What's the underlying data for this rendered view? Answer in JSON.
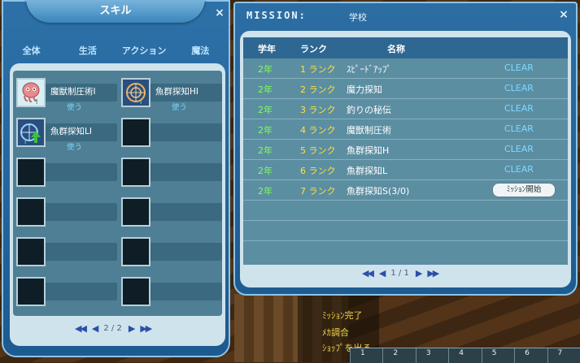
{
  "skill_window": {
    "title": "スキル",
    "close": "×",
    "tabs": [
      "全体",
      "生活",
      "アクション",
      "魔法"
    ],
    "slots": [
      {
        "name": "魔獣制圧術Ⅰ",
        "action": "使う",
        "icon": "octopus-icon"
      },
      {
        "name": "魚群探知HⅠ",
        "action": "使う",
        "icon": "fish-radar-icon"
      },
      {
        "name": "魚群探知LⅠ",
        "action": "使う",
        "icon": "fish-radar-up-icon"
      },
      {
        "name": "",
        "action": "",
        "icon": "empty-slot"
      },
      {
        "name": "",
        "action": "",
        "icon": "empty-slot"
      },
      {
        "name": "",
        "action": "",
        "icon": "empty-slot"
      },
      {
        "name": "",
        "action": "",
        "icon": "empty-slot"
      },
      {
        "name": "",
        "action": "",
        "icon": "empty-slot"
      },
      {
        "name": "",
        "action": "",
        "icon": "empty-slot"
      },
      {
        "name": "",
        "action": "",
        "icon": "empty-slot"
      },
      {
        "name": "",
        "action": "",
        "icon": "empty-slot"
      },
      {
        "name": "",
        "action": "",
        "icon": "empty-slot"
      }
    ],
    "pager": {
      "first": "◀◀",
      "prev": "◀",
      "page": "2 / 2",
      "next": "▶",
      "last": "▶▶"
    }
  },
  "mission_window": {
    "title": "MISSION:",
    "subtitle": "学校",
    "close": "×",
    "headers": {
      "year": "学年",
      "rank": "ランク",
      "name": "名称"
    },
    "rows": [
      {
        "year": "2年",
        "rank": "1 ランク",
        "name": "ｽﾋﾟｰﾄﾞｱｯﾌﾟ",
        "status": "CLEAR"
      },
      {
        "year": "2年",
        "rank": "2 ランク",
        "name": "魔力探知",
        "status": "CLEAR"
      },
      {
        "year": "2年",
        "rank": "3 ランク",
        "name": "釣りの秘伝",
        "status": "CLEAR"
      },
      {
        "year": "2年",
        "rank": "4 ランク",
        "name": "魔獣制圧術",
        "status": "CLEAR"
      },
      {
        "year": "2年",
        "rank": "5 ランク",
        "name": "魚群探知H",
        "status": "CLEAR"
      },
      {
        "year": "2年",
        "rank": "6 ランク",
        "name": "魚群探知L",
        "status": "CLEAR"
      },
      {
        "year": "2年",
        "rank": "7 ランク",
        "name": "魚群探知S(3/0)",
        "status": "",
        "button": "ﾐｯｼｮﾝ開始"
      }
    ],
    "pager": {
      "first": "◀◀",
      "prev": "◀",
      "page": "1 / 1",
      "next": "▶",
      "last": "▶▶"
    }
  },
  "background_log": [
    "ﾐｯｼｮﾝ完了",
    "ﾒｶ調合",
    "ｼｮｯﾌﾟを出る"
  ],
  "hotbar": [
    "1",
    "2",
    "3",
    "4",
    "5",
    "6",
    "7"
  ],
  "colors": {
    "window": "#2d71a8",
    "panel": "#cfe3ec",
    "year": "#7fff5a",
    "rank": "#ffe23a",
    "clear": "#7fd8ff"
  }
}
